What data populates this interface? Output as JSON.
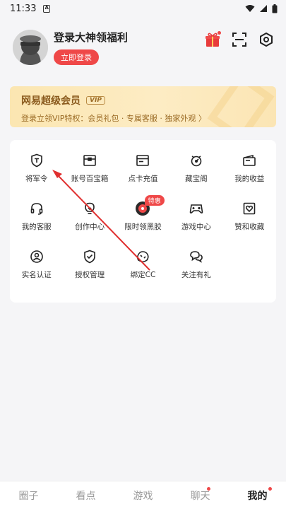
{
  "status_bar": {
    "time": "11:33"
  },
  "profile": {
    "title": "登录大神领福利",
    "login_label": "立即登录"
  },
  "vip": {
    "title": "网易超级会员",
    "tag": "VIP",
    "subtitle": "登录立领VIP特权：会员礼包 · 专属客服 · 独家外观 〉"
  },
  "grid": {
    "rows": [
      [
        {
          "label": "将军令",
          "icon": "shield-t-icon"
        },
        {
          "label": "账号百宝箱",
          "icon": "treasure-box-icon"
        },
        {
          "label": "点卡充值",
          "icon": "card-icon"
        },
        {
          "label": "藏宝阁",
          "icon": "treasure-pavilion-icon"
        },
        {
          "label": "我的收益",
          "icon": "wallet-icon"
        }
      ],
      [
        {
          "label": "我的客服",
          "icon": "headset-icon"
        },
        {
          "label": "创作中心",
          "icon": "lightbulb-icon"
        },
        {
          "label": "限时领黑胶",
          "icon": "vinyl-icon",
          "badge": "特惠"
        },
        {
          "label": "游戏中心",
          "icon": "gamepad-icon"
        },
        {
          "label": "赞和收藏",
          "icon": "heart-frame-icon"
        }
      ],
      [
        {
          "label": "实名认证",
          "icon": "user-circle-icon"
        },
        {
          "label": "授权管理",
          "icon": "shield-check-icon"
        },
        {
          "label": "绑定CC",
          "icon": "cc-icon"
        },
        {
          "label": "关注有礼",
          "icon": "chat-bubbles-icon"
        }
      ]
    ]
  },
  "tabs": [
    {
      "label": "圈子",
      "active": false,
      "dot": false
    },
    {
      "label": "看点",
      "active": false,
      "dot": false
    },
    {
      "label": "游戏",
      "active": false,
      "dot": false
    },
    {
      "label": "聊天",
      "active": false,
      "dot": true
    },
    {
      "label": "我的",
      "active": true,
      "dot": true
    }
  ],
  "colors": {
    "accent": "#ef4848",
    "vip_text": "#8a5a1d"
  }
}
